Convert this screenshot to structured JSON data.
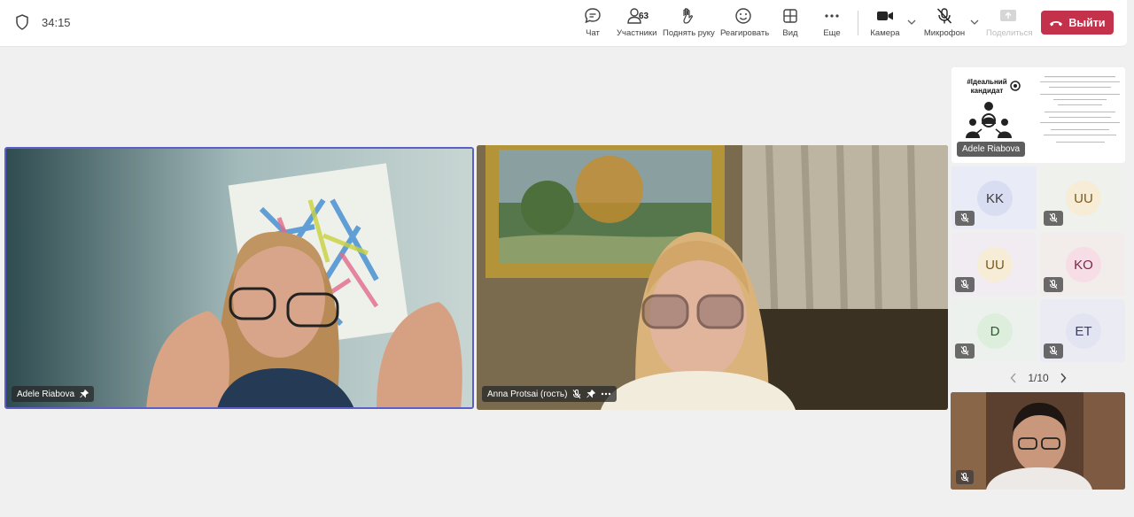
{
  "meeting": {
    "timer": "34:15"
  },
  "toolbar": {
    "chat": "Чат",
    "participants": "Участники",
    "participants_count": "63",
    "raise_hand": "Поднять руку",
    "react": "Реагировать",
    "view": "Вид",
    "more": "Еще",
    "camera": "Камера",
    "microphone": "Микрофон",
    "share": "Поделиться",
    "leave": "Выйти"
  },
  "tiles": {
    "main_left": {
      "name": "Adele Riabova"
    },
    "main_right": {
      "name": "Anna Protsai (гость)"
    },
    "shared_content": {
      "name": "Adele Riabova",
      "slide_title": "#Ідеальний кандидат"
    }
  },
  "gallery": [
    {
      "initials": "KK",
      "color": "#e3e6f7"
    },
    {
      "initials": "UU",
      "color": "#f7ecd6"
    },
    {
      "initials": "UU",
      "color": "#f7ecd6"
    },
    {
      "initials": "KO",
      "color": "#f6dde6"
    },
    {
      "initials": "D",
      "color": "#ddeedd"
    },
    {
      "initials": "ET",
      "color": "#e2e4f2"
    }
  ],
  "pagination": {
    "label": "1/10"
  },
  "colors": {
    "leave": "#c4314b",
    "active_speaker_border": "#5b5fc7"
  }
}
